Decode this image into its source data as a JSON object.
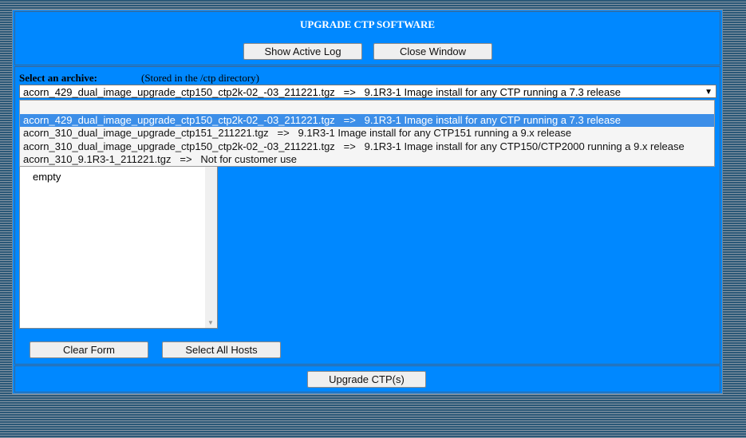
{
  "header": {
    "title": "UPGRADE CTP SOFTWARE",
    "show_log": "Show Active Log",
    "close": "Close Window"
  },
  "archive": {
    "label": "Select an archive:",
    "note": "(Stored in the /ctp directory)",
    "selected": "acorn_429_dual_image_upgrade_ctp150_ctp2k-02_-03_211221.tgz   =>   9.1R3-1 Image install for any CTP running a 7.3 release",
    "options": [
      "",
      "acorn_429_dual_image_upgrade_ctp150_ctp2k-02_-03_211221.tgz   =>   9.1R3-1 Image install for any CTP running a 7.3 release",
      "acorn_310_dual_image_upgrade_ctp151_211221.tgz   =>   9.1R3-1 Image install for any CTP151 running a 9.x release",
      "acorn_310_dual_image_upgrade_ctp150_ctp2k-02_-03_211221.tgz   =>   9.1R3-1 Image install for any CTP150/CTP2000 running a 9.x release",
      "acorn_310_9.1R3-1_211221.tgz   =>   Not for customer use"
    ]
  },
  "hosts": {
    "items": [
      "empty"
    ]
  },
  "buttons": {
    "clear": "Clear Form",
    "select_all": "Select All  Hosts",
    "upgrade": "Upgrade CTP(s)"
  }
}
